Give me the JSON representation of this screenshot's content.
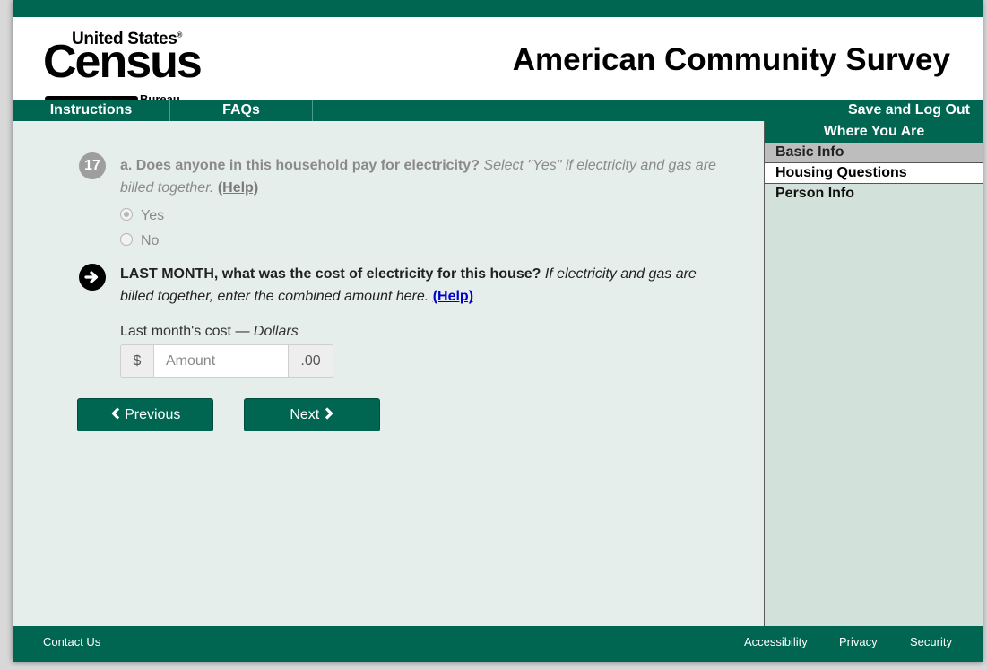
{
  "header": {
    "logo": {
      "line1": "United States",
      "mark": "®",
      "main": "Census",
      "sub": "Bureau"
    },
    "title": "American Community Survey"
  },
  "nav": {
    "instructions": "Instructions",
    "faqs": "FAQs",
    "save": "Save and Log Out"
  },
  "sidebar": {
    "heading": "Where You Are",
    "items": [
      {
        "label": "Basic Info",
        "state": "completed"
      },
      {
        "label": "Housing Questions",
        "state": "current"
      },
      {
        "label": "Person Info",
        "state": "pending"
      }
    ]
  },
  "question17": {
    "number": "17",
    "prefix": "a. Does anyone in this household pay for electricity?",
    "hint": "Select \"Yes\" if electricity and gas are billed together.",
    "help": "(Help)",
    "options": [
      {
        "label": "Yes",
        "selected": true
      },
      {
        "label": "No",
        "selected": false
      }
    ]
  },
  "question17b": {
    "prefix": "LAST MONTH, what was the cost of electricity for this house?",
    "hint": "If electricity and gas are billed together, enter the combined amount here.",
    "help": "(Help)",
    "cost_label": "Last month's cost —",
    "cost_unit": "Dollars",
    "currency": "$",
    "placeholder": "Amount",
    "value": "",
    "cents": ".00"
  },
  "buttons": {
    "previous": "Previous",
    "next": "Next"
  },
  "footer": {
    "contact": "Contact Us",
    "accessibility": "Accessibility",
    "privacy": "Privacy",
    "security": "Security"
  },
  "colors": {
    "brand_green": "#006651",
    "background": "#e6eeeb",
    "sidebar": "#d3e1db"
  }
}
